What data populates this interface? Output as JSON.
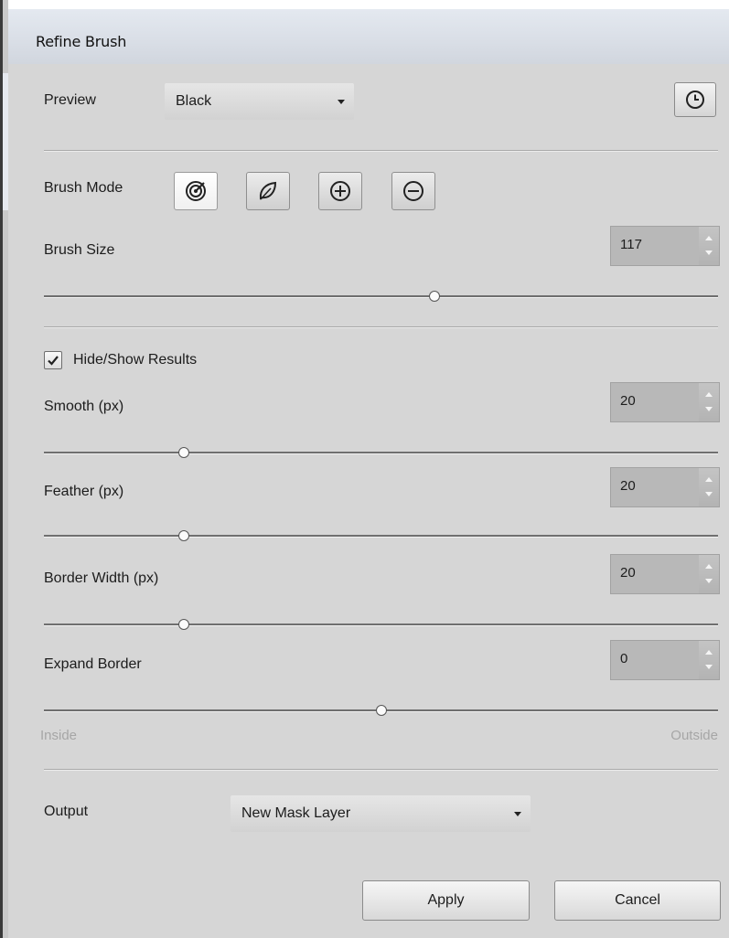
{
  "window": {
    "title": "Refine Brush"
  },
  "preview": {
    "label": "Preview",
    "selected": "Black",
    "history_button_icon": "clock-icon"
  },
  "brush_mode": {
    "label": "Brush Mode",
    "buttons": [
      {
        "icon": "target-brush-icon",
        "active": true
      },
      {
        "icon": "leaf-brush-icon",
        "active": false
      },
      {
        "icon": "plus-circle-icon",
        "active": false
      },
      {
        "icon": "minus-circle-icon",
        "active": false
      }
    ]
  },
  "brush_size": {
    "label": "Brush Size",
    "value": "117",
    "slider_fraction": 0.58
  },
  "hide_show": {
    "label": "Hide/Show Results",
    "checked": true
  },
  "smooth": {
    "label": "Smooth (px)",
    "value": "20",
    "slider_fraction": 0.208
  },
  "feather": {
    "label": "Feather (px)",
    "value": "20",
    "slider_fraction": 0.208
  },
  "border_width": {
    "label": "Border Width (px)",
    "value": "20",
    "slider_fraction": 0.208
  },
  "expand_border": {
    "label": "Expand Border",
    "value": "0",
    "slider_fraction": 0.5,
    "min_label": "Inside",
    "max_label": "Outside"
  },
  "output": {
    "label": "Output",
    "selected": "New Mask Layer"
  },
  "actions": {
    "apply_label": "Apply",
    "cancel_label": "Cancel"
  },
  "colors": {
    "panel_bg": "#d6d6d6",
    "spin_bg": "#b8b8b8",
    "faint_text": "#a6a6a6"
  }
}
